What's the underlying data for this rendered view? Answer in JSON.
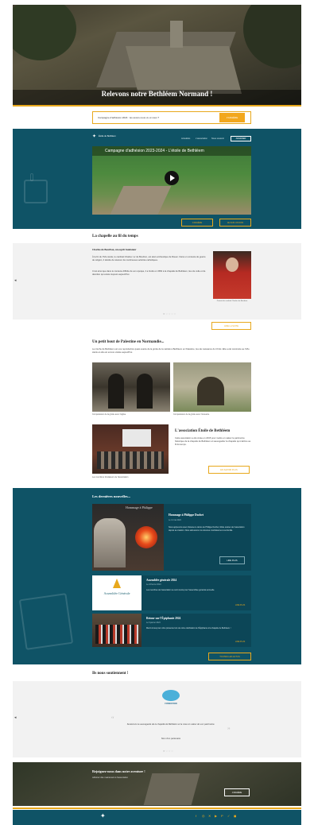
{
  "hero": {
    "title": "Relevons notre Bethléem Normand !"
  },
  "campaign_strip": {
    "text": "Campagne d'adhésion 2024 : les avons-nous vu et vous ?",
    "button": "J'ADHÈRE"
  },
  "video_section": {
    "brand": "Étoile de Bethléem",
    "nav": [
      "Actualités",
      "L'association",
      "Nous soutenir"
    ],
    "nav_button": "ADHÉRER",
    "video_title": "Campagne d'adhésion 2023-2024 - L'étoile de Bethléem",
    "buttons": [
      "J'ADHÈRE",
      "JE FAIS UN DON"
    ]
  },
  "chapel": {
    "title": "La chapelle au fil du temps",
    "subtitle": "Charles de Bourbon, un esprit fondateur",
    "text1": "À la fin du XVIe siècle, le cardinal Charles I er de Bourbon, est alors archevêque de Rouen. Dans un contexte de guerre de religion, il décide de relancer de nombreuses activités catholiques.",
    "text2": "C'est ainsi que dans le contexte difficile de son époque, il a fondé en 1582 à la chapelle de Bethléem, lieu de culte et de dévotion qui existe toujours aujourd'hui.",
    "portrait_caption": "Portrait du cardinal Charles de Bourbon",
    "button": "LIRE LA SUITE"
  },
  "palestine": {
    "title": "Un petit bout de Palestine en Normandie...",
    "text": "La crèche de Bethléem est une reproduction quasi exacte de la grotte de la nativité à Bethléem en Palestine, lieu de naissance du Christ. Elle a été construite au XVIe siècle et elle est encore visitée aujourd'hui.",
    "caption1": "Comparaison de la grotte avec l'église",
    "caption2": "Comparaison de la grotte avec l'ossuaire"
  },
  "association": {
    "title": "L'association Étoile de Bethléem",
    "text": "Cette association a été créée en 2015 pour mettre en valeur le patrimoine historique de la chapelle de Bethléem et sauvegarder la chapelle qui s'abîme au fil du temps.",
    "caption": "Les membres fondateurs de l'association",
    "button": "EN SAVOIR PLUS"
  },
  "news": {
    "title": "Les dernières nouvelles...",
    "featured": {
      "image_text": "Hommage à Philippe",
      "title": "Hommage à Philippe Duchet",
      "date": "Le 14 mai 2024",
      "text": "Nous apprenons avec tristesse le décès de Philippe Duchet, fidèle soutien de l'association depuis sa création. Nous adressons nos sincères condoléances à sa famille.",
      "button": "LIRE PLUS"
    },
    "items": [
      {
        "title": "Assemblée générale 2024",
        "date": "Le 24 février 2024",
        "text": "Les membres de l'association se sont réunis pour l'assemblée générale annuelle.",
        "image_text": "Assemblée Générale",
        "link": "LIRE PLUS"
      },
      {
        "title": "Retour sur l'Épiphanie 2024",
        "date": "Le 6 janvier 2024",
        "text": "Merci à tous pour votre présence lors de notre célébration de l'Épiphanie à la chapelle de Bethléem !",
        "link": "LIRE PLUS"
      }
    ],
    "all_button": "TOUTES LES ACTUS"
  },
  "support": {
    "title": "Ils nous soutiennent !",
    "logo_text": "FONDATION",
    "quote": "Soutenons la sauvegarde de la chapelle de Bethléem et la mise en valeur de son patrimoine.",
    "author": "Nom d'un partenaire"
  },
  "join": {
    "title": "Rejoignez-nous dans notre aventure !",
    "text": "Adhérez dès maintenant à l'association",
    "button": "J'ADHÈRE"
  }
}
